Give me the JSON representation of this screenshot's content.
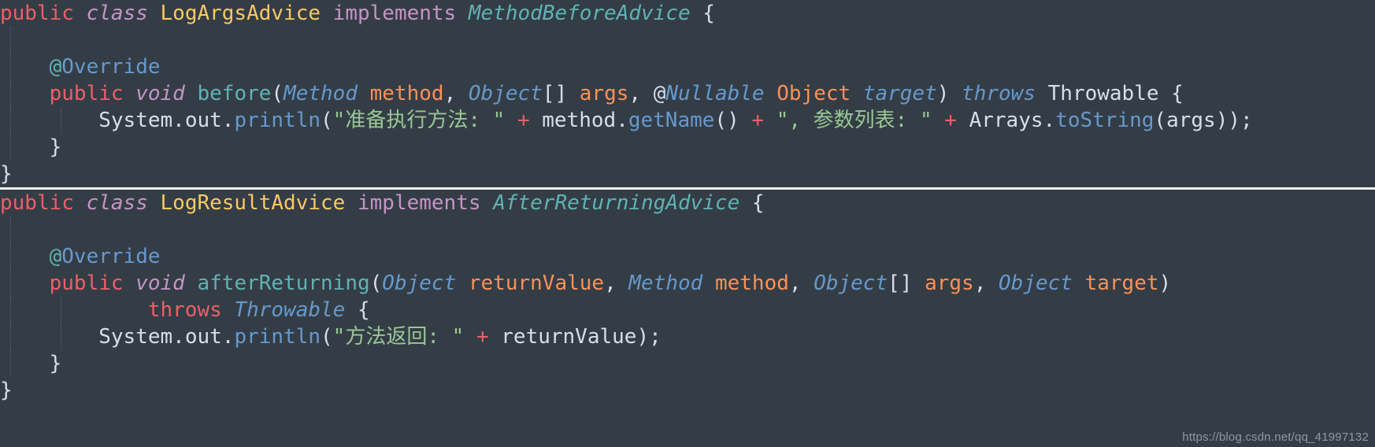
{
  "editor": {
    "background_color": "#343d46",
    "default_text_color": "#d8dee9",
    "divider_color": "#f2f2f2",
    "theme_name": "oceanic-next-dark"
  },
  "colors": {
    "keyword_red": "#ec5f67",
    "keyword_purple": "#c594c5",
    "class_yellow": "#fac863",
    "interface_green": "#5fb3b3",
    "type_blue": "#6699cc",
    "param_orange": "#f99157",
    "string_green": "#99c794",
    "plain_text": "#d8dee9",
    "guide_gray": "#59626b"
  },
  "blocks": [
    {
      "id": "log-args-advice",
      "class_name": "LogArgsAdvice",
      "interface_name": "MethodBeforeAdvice",
      "lines": [
        {
          "n": 1,
          "indent_guides": [],
          "tokens": [
            {
              "t": "public",
              "c": "kw"
            },
            {
              "t": " ",
              "c": "plain"
            },
            {
              "t": "class",
              "c": "kw-i"
            },
            {
              "t": " ",
              "c": "plain"
            },
            {
              "t": "LogArgsAdvice",
              "c": "type-y"
            },
            {
              "t": " ",
              "c": "plain"
            },
            {
              "t": "implements",
              "c": "kw-p"
            },
            {
              "t": " ",
              "c": "plain"
            },
            {
              "t": "MethodBeforeAdvice",
              "c": "type-g"
            },
            {
              "t": " {",
              "c": "plain"
            }
          ]
        },
        {
          "n": 2,
          "indent_guides": [
            "g0"
          ],
          "tokens": []
        },
        {
          "n": 3,
          "indent_guides": [
            "g0"
          ],
          "tokens": [
            {
              "t": "    ",
              "c": "plain"
            },
            {
              "t": "@",
              "c": "ann-at"
            },
            {
              "t": "Override",
              "c": "ann"
            }
          ]
        },
        {
          "n": 4,
          "indent_guides": [
            "g0"
          ],
          "tokens": [
            {
              "t": "    ",
              "c": "plain"
            },
            {
              "t": "public",
              "c": "kw"
            },
            {
              "t": " ",
              "c": "plain"
            },
            {
              "t": "void",
              "c": "kw-i"
            },
            {
              "t": " ",
              "c": "plain"
            },
            {
              "t": "before",
              "c": "meth"
            },
            {
              "t": "(",
              "c": "plain"
            },
            {
              "t": "Method",
              "c": "type-b"
            },
            {
              "t": " ",
              "c": "plain"
            },
            {
              "t": "method",
              "c": "param"
            },
            {
              "t": ", ",
              "c": "plain"
            },
            {
              "t": "Object",
              "c": "type-b"
            },
            {
              "t": "[] ",
              "c": "plain"
            },
            {
              "t": "args",
              "c": "param"
            },
            {
              "t": ", ",
              "c": "plain"
            },
            {
              "t": "@",
              "c": "plain"
            },
            {
              "t": "Nullable",
              "c": "type-b"
            },
            {
              "t": " ",
              "c": "plain"
            },
            {
              "t": "Object",
              "c": "param"
            },
            {
              "t": " ",
              "c": "plain"
            },
            {
              "t": "target",
              "c": "type-b"
            },
            {
              "t": ") ",
              "c": "plain"
            },
            {
              "t": "throws",
              "c": "type-b"
            },
            {
              "t": " ",
              "c": "plain"
            },
            {
              "t": "Throwable",
              "c": "plain"
            },
            {
              "t": " {",
              "c": "plain"
            }
          ]
        },
        {
          "n": 5,
          "indent_guides": [
            "g0",
            "g1"
          ],
          "tokens": [
            {
              "t": "        ",
              "c": "plain"
            },
            {
              "t": "System",
              "c": "plain"
            },
            {
              "t": ".",
              "c": "plain"
            },
            {
              "t": "out",
              "c": "plain"
            },
            {
              "t": ".",
              "c": "plain"
            },
            {
              "t": "println",
              "c": "call"
            },
            {
              "t": "(",
              "c": "plain"
            },
            {
              "t": "\"准备执行方法: \"",
              "c": "str"
            },
            {
              "t": " ",
              "c": "plain"
            },
            {
              "t": "+",
              "c": "op"
            },
            {
              "t": " ",
              "c": "plain"
            },
            {
              "t": "method",
              "c": "plain"
            },
            {
              "t": ".",
              "c": "plain"
            },
            {
              "t": "getName",
              "c": "call"
            },
            {
              "t": "() ",
              "c": "plain"
            },
            {
              "t": "+",
              "c": "op"
            },
            {
              "t": " ",
              "c": "plain"
            },
            {
              "t": "\", 参数列表: \"",
              "c": "str"
            },
            {
              "t": " ",
              "c": "plain"
            },
            {
              "t": "+",
              "c": "op"
            },
            {
              "t": " ",
              "c": "plain"
            },
            {
              "t": "Arrays",
              "c": "plain"
            },
            {
              "t": ".",
              "c": "plain"
            },
            {
              "t": "toString",
              "c": "call"
            },
            {
              "t": "(",
              "c": "plain"
            },
            {
              "t": "args",
              "c": "plain"
            },
            {
              "t": "));",
              "c": "plain"
            }
          ]
        },
        {
          "n": 6,
          "indent_guides": [
            "g0"
          ],
          "tokens": [
            {
              "t": "    }",
              "c": "plain"
            }
          ]
        },
        {
          "n": 7,
          "indent_guides": [],
          "tokens": [
            {
              "t": "}",
              "c": "plain"
            }
          ]
        }
      ]
    },
    {
      "id": "log-result-advice",
      "class_name": "LogResultAdvice",
      "interface_name": "AfterReturningAdvice",
      "lines": [
        {
          "n": 1,
          "indent_guides": [],
          "tokens": [
            {
              "t": "public",
              "c": "kw"
            },
            {
              "t": " ",
              "c": "plain"
            },
            {
              "t": "class",
              "c": "kw-i"
            },
            {
              "t": " ",
              "c": "plain"
            },
            {
              "t": "LogResultAdvice",
              "c": "type-y"
            },
            {
              "t": " ",
              "c": "plain"
            },
            {
              "t": "implements",
              "c": "kw-p"
            },
            {
              "t": " ",
              "c": "plain"
            },
            {
              "t": "AfterReturningAdvice",
              "c": "type-g"
            },
            {
              "t": " {",
              "c": "plain"
            }
          ]
        },
        {
          "n": 2,
          "indent_guides": [
            "g0"
          ],
          "tokens": []
        },
        {
          "n": 3,
          "indent_guides": [
            "g0"
          ],
          "tokens": [
            {
              "t": "    ",
              "c": "plain"
            },
            {
              "t": "@",
              "c": "ann-at"
            },
            {
              "t": "Override",
              "c": "ann"
            }
          ]
        },
        {
          "n": 4,
          "indent_guides": [
            "g0"
          ],
          "tokens": [
            {
              "t": "    ",
              "c": "plain"
            },
            {
              "t": "public",
              "c": "kw"
            },
            {
              "t": " ",
              "c": "plain"
            },
            {
              "t": "void",
              "c": "kw-i"
            },
            {
              "t": " ",
              "c": "plain"
            },
            {
              "t": "afterReturning",
              "c": "meth"
            },
            {
              "t": "(",
              "c": "plain"
            },
            {
              "t": "Object",
              "c": "type-b"
            },
            {
              "t": " ",
              "c": "plain"
            },
            {
              "t": "returnValue",
              "c": "param"
            },
            {
              "t": ", ",
              "c": "plain"
            },
            {
              "t": "Method",
              "c": "type-b"
            },
            {
              "t": " ",
              "c": "plain"
            },
            {
              "t": "method",
              "c": "param"
            },
            {
              "t": ", ",
              "c": "plain"
            },
            {
              "t": "Object",
              "c": "type-b"
            },
            {
              "t": "[] ",
              "c": "plain"
            },
            {
              "t": "args",
              "c": "param"
            },
            {
              "t": ", ",
              "c": "plain"
            },
            {
              "t": "Object",
              "c": "type-b"
            },
            {
              "t": " ",
              "c": "plain"
            },
            {
              "t": "target",
              "c": "param"
            },
            {
              "t": ")",
              "c": "plain"
            }
          ]
        },
        {
          "n": 5,
          "indent_guides": [
            "g0",
            "g1"
          ],
          "tokens": [
            {
              "t": "            ",
              "c": "plain"
            },
            {
              "t": "throws",
              "c": "kw"
            },
            {
              "t": " ",
              "c": "plain"
            },
            {
              "t": "Throwable",
              "c": "type-p"
            },
            {
              "t": " {",
              "c": "plain"
            }
          ]
        },
        {
          "n": 6,
          "indent_guides": [
            "g0",
            "g1"
          ],
          "tokens": [
            {
              "t": "        ",
              "c": "plain"
            },
            {
              "t": "System",
              "c": "plain"
            },
            {
              "t": ".",
              "c": "plain"
            },
            {
              "t": "out",
              "c": "plain"
            },
            {
              "t": ".",
              "c": "plain"
            },
            {
              "t": "println",
              "c": "call"
            },
            {
              "t": "(",
              "c": "plain"
            },
            {
              "t": "\"方法返回: \"",
              "c": "str"
            },
            {
              "t": " ",
              "c": "plain"
            },
            {
              "t": "+",
              "c": "op"
            },
            {
              "t": " ",
              "c": "plain"
            },
            {
              "t": "returnValue",
              "c": "plain"
            },
            {
              "t": ");",
              "c": "plain"
            }
          ]
        },
        {
          "n": 7,
          "indent_guides": [
            "g0"
          ],
          "tokens": [
            {
              "t": "    }",
              "c": "plain"
            }
          ]
        },
        {
          "n": 8,
          "indent_guides": [],
          "tokens": [
            {
              "t": "}",
              "c": "plain"
            }
          ]
        }
      ]
    }
  ],
  "watermark": {
    "text": "https://blog.csdn.net/qq_41997132"
  }
}
